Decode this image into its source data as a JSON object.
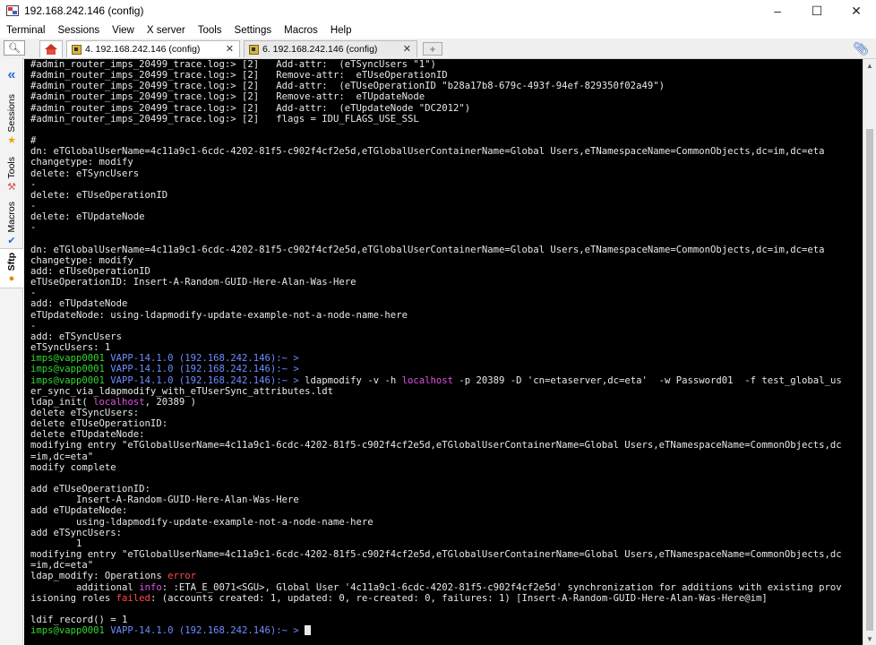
{
  "window": {
    "title": "192.168.242.146 (config)",
    "minimize": "–",
    "maximize": "☐",
    "close": "✕"
  },
  "menu": {
    "items": [
      "Terminal",
      "Sessions",
      "View",
      "X server",
      "Tools",
      "Settings",
      "Macros",
      "Help"
    ]
  },
  "tabs": [
    {
      "label": "4. 192.168.242.146 (config)",
      "active": true,
      "close": "✕"
    },
    {
      "label": "6. 192.168.242.146 (config)",
      "active": false,
      "close": "✕"
    }
  ],
  "new_tab_symbol": "+",
  "sidebar": {
    "items": [
      "Sessions",
      "Tools",
      "Macros",
      "Sftp"
    ]
  },
  "icons": {
    "quick_search": "search-icon",
    "home": "home-icon",
    "attach": "paperclip-icon",
    "collapse": "double-chevron-left-icon"
  },
  "colors": {
    "prompt_green": "#33d633",
    "prompt_blue": "#6f8cff",
    "highlight_magenta": "#e34fe3",
    "error_red": "#ff4a4a"
  },
  "terminal": {
    "lines": [
      [
        {
          "t": "#admin_router_imps_20499_trace.log:> [2]   Add-attr:  (eTSyncUsers \"1\")"
        }
      ],
      [
        {
          "t": "#admin_router_imps_20499_trace.log:> [2]   Remove-attr:  eTUseOperationID"
        }
      ],
      [
        {
          "t": "#admin_router_imps_20499_trace.log:> [2]   Add-attr:  (eTUseOperationID \"b28a17b8-679c-493f-94ef-829350f02a49\")"
        }
      ],
      [
        {
          "t": "#admin_router_imps_20499_trace.log:> [2]   Remove-attr:  eTUpdateNode"
        }
      ],
      [
        {
          "t": "#admin_router_imps_20499_trace.log:> [2]   Add-attr:  (eTUpdateNode \"DC2012\")"
        }
      ],
      [
        {
          "t": "#admin_router_imps_20499_trace.log:> [2]   flags = IDU_FLAGS_USE_SSL"
        }
      ],
      [
        {
          "t": ""
        }
      ],
      [
        {
          "t": "#"
        }
      ],
      [
        {
          "t": "dn: eTGlobalUserName=4c11a9c1-6cdc-4202-81f5-c902f4cf2e5d,eTGlobalUserContainerName=Global Users,eTNamespaceName=CommonObjects,dc=im,dc=eta"
        }
      ],
      [
        {
          "t": "changetype: modify"
        }
      ],
      [
        {
          "t": "delete: eTSyncUsers"
        }
      ],
      [
        {
          "t": "-"
        }
      ],
      [
        {
          "t": "delete: eTUseOperationID"
        }
      ],
      [
        {
          "t": "-"
        }
      ],
      [
        {
          "t": "delete: eTUpdateNode"
        }
      ],
      [
        {
          "t": "-"
        }
      ],
      [
        {
          "t": ""
        }
      ],
      [
        {
          "t": "dn: eTGlobalUserName=4c11a9c1-6cdc-4202-81f5-c902f4cf2e5d,eTGlobalUserContainerName=Global Users,eTNamespaceName=CommonObjects,dc=im,dc=eta"
        }
      ],
      [
        {
          "t": "changetype: modify"
        }
      ],
      [
        {
          "t": "add: eTUseOperationID"
        }
      ],
      [
        {
          "t": "eTUseOperationID: Insert-A-Random-GUID-Here-Alan-Was-Here"
        }
      ],
      [
        {
          "t": "-"
        }
      ],
      [
        {
          "t": "add: eTUpdateNode"
        }
      ],
      [
        {
          "t": "eTUpdateNode: using-ldapmodify-update-example-not-a-node-name-here"
        }
      ],
      [
        {
          "t": "-"
        }
      ],
      [
        {
          "t": "add: eTSyncUsers"
        }
      ],
      [
        {
          "t": "eTSyncUsers: 1"
        }
      ],
      [
        {
          "t": "imps@vapp0001 ",
          "c": "g"
        },
        {
          "t": "VAPP-14.1.0 (192.168.242.146):~ >",
          "c": "b"
        }
      ],
      [
        {
          "t": "imps@vapp0001 ",
          "c": "g"
        },
        {
          "t": "VAPP-14.1.0 (192.168.242.146):~ >",
          "c": "b"
        }
      ],
      [
        {
          "t": "imps@vapp0001 ",
          "c": "g"
        },
        {
          "t": "VAPP-14.1.0 (192.168.242.146):~ >",
          "c": "b"
        },
        {
          "t": " ldapmodify -v -h "
        },
        {
          "t": "localhost",
          "c": "m"
        },
        {
          "t": " -p 20389 -D 'cn=etaserver,dc=eta'  -w Password01  -f test_global_us"
        }
      ],
      [
        {
          "t": "er_sync_via_ldapmodify_with_eTUserSync_attributes.ldt"
        }
      ],
      [
        {
          "t": "ldap_init( "
        },
        {
          "t": "localhost",
          "c": "m"
        },
        {
          "t": ", 20389 )"
        }
      ],
      [
        {
          "t": "delete eTSyncUsers:"
        }
      ],
      [
        {
          "t": "delete eTUseOperationID:"
        }
      ],
      [
        {
          "t": "delete eTUpdateNode:"
        }
      ],
      [
        {
          "t": "modifying entry \"eTGlobalUserName=4c11a9c1-6cdc-4202-81f5-c902f4cf2e5d,eTGlobalUserContainerName=Global Users,eTNamespaceName=CommonObjects,dc"
        }
      ],
      [
        {
          "t": "=im,dc=eta\""
        }
      ],
      [
        {
          "t": "modify complete"
        }
      ],
      [
        {
          "t": ""
        }
      ],
      [
        {
          "t": "add eTUseOperationID:"
        }
      ],
      [
        {
          "t": "        Insert-A-Random-GUID-Here-Alan-Was-Here"
        }
      ],
      [
        {
          "t": "add eTUpdateNode:"
        }
      ],
      [
        {
          "t": "        using-ldapmodify-update-example-not-a-node-name-here"
        }
      ],
      [
        {
          "t": "add eTSyncUsers:"
        }
      ],
      [
        {
          "t": "        1"
        }
      ],
      [
        {
          "t": "modifying entry \"eTGlobalUserName=4c11a9c1-6cdc-4202-81f5-c902f4cf2e5d,eTGlobalUserContainerName=Global Users,eTNamespaceName=CommonObjects,dc"
        }
      ],
      [
        {
          "t": "=im,dc=eta\""
        }
      ],
      [
        {
          "t": "ldap_modify: Operations "
        },
        {
          "t": "error",
          "c": "r"
        }
      ],
      [
        {
          "t": "        additional "
        },
        {
          "t": "info",
          "c": "m"
        },
        {
          "t": ": :ETA_E_0071<SGU>, Global User '4c11a9c1-6cdc-4202-81f5-c902f4cf2e5d' synchronization for additions with existing prov"
        }
      ],
      [
        {
          "t": "isioning roles "
        },
        {
          "t": "failed",
          "c": "r"
        },
        {
          "t": ": (accounts created: 1, updated: 0, re-created: 0, failures: 1) [Insert-A-Random-GUID-Here-Alan-Was-Here@im]"
        }
      ],
      [
        {
          "t": ""
        }
      ],
      [
        {
          "t": "ldif_record() = 1"
        }
      ],
      [
        {
          "t": "imps@vapp0001 ",
          "c": "g"
        },
        {
          "t": "VAPP-14.1.0 (192.168.242.146):~ >",
          "c": "b"
        },
        {
          "t": " "
        }
      ]
    ]
  }
}
